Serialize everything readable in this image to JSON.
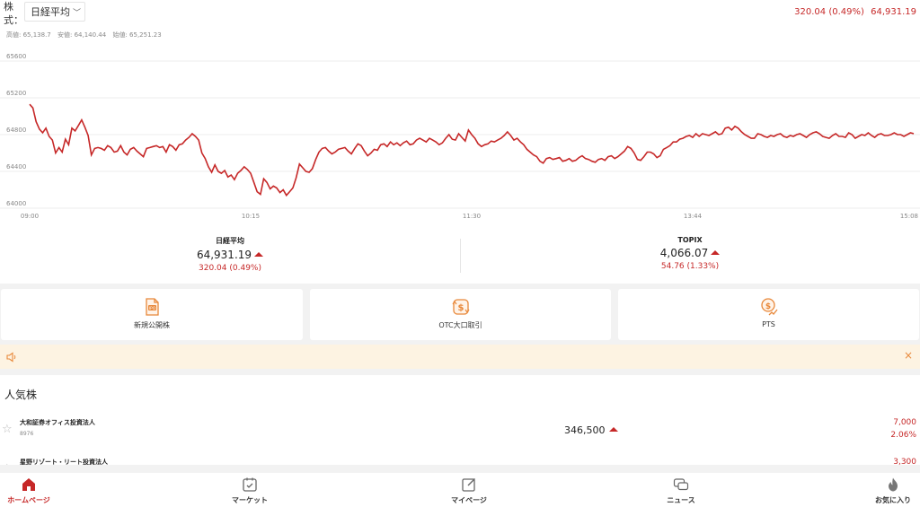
{
  "market": {
    "stock_label": "株式：",
    "selected_index": "日経平均",
    "top_change": "320.04 (0.49%)",
    "top_price": "64,931.19",
    "stats": [
      "高値: 65,138.7",
      "安値: 64,140.44",
      "始値: 65,251.23"
    ]
  },
  "chart_data": {
    "type": "line",
    "x_ticks": [
      "09:00",
      "10:15",
      "11:30",
      "13:44",
      "15:08"
    ],
    "y_ticks": [
      "65600",
      "65200",
      "64800",
      "64400",
      "64000"
    ],
    "ylim": [
      64000,
      65600
    ],
    "color": "#c62828",
    "grid": true,
    "series": [
      {
        "values": [
          65130,
          65090,
          64940,
          64860,
          64820,
          64870,
          64780,
          64740,
          64600,
          64660,
          64610,
          64750,
          64690,
          64870,
          64840,
          64900,
          64960,
          64880,
          64790,
          64580,
          64650,
          64660,
          64650,
          64630,
          64680,
          64660,
          64610,
          64620,
          64680,
          64610,
          64580,
          64640,
          64660,
          64620,
          64590,
          64560,
          64650,
          64660,
          64670,
          64680,
          64660,
          64670,
          64610,
          64690,
          64670,
          64630,
          64690,
          64700,
          64740,
          64770,
          64810,
          64780,
          64740,
          64600,
          64540,
          64450,
          64390,
          64470,
          64400,
          64380,
          64410,
          64340,
          64360,
          64310,
          64380,
          64410,
          64450,
          64420,
          64380,
          64280,
          64180,
          64150,
          64320,
          64280,
          64210,
          64240,
          64220,
          64170,
          64200,
          64140,
          64180,
          64220,
          64330,
          64480,
          64440,
          64400,
          64390,
          64430,
          64530,
          64610,
          64650,
          64660,
          64620,
          64590,
          64610,
          64640,
          64650,
          64660,
          64620,
          64590,
          64650,
          64700,
          64680,
          64620,
          64570,
          64600,
          64640,
          64630,
          64690,
          64700,
          64670,
          64720,
          64690,
          64710,
          64680,
          64710,
          64730,
          64690,
          64700,
          64740,
          64760,
          64740,
          64720,
          64760,
          64740,
          64720,
          64690,
          64710,
          64760,
          64800,
          64750,
          64740,
          64810,
          64770,
          64730,
          64850,
          64800,
          64760,
          64700,
          64670,
          64690,
          64700,
          64730,
          64720,
          64740,
          64760,
          64790,
          64830,
          64790,
          64740,
          64760,
          64720,
          64690,
          64640,
          64610,
          64580,
          64560,
          64510,
          64490,
          64540,
          64550,
          64530,
          64540,
          64550,
          64510,
          64520,
          64540,
          64510,
          64520,
          64550,
          64570,
          64540,
          64530,
          64510,
          64500,
          64530,
          64540,
          64520,
          64560,
          64570,
          64540,
          64560,
          64590,
          64620,
          64670,
          64650,
          64600,
          64530,
          64520,
          64560,
          64610,
          64610,
          64590,
          64550,
          64570,
          64640,
          64660,
          64680,
          64720,
          64720,
          64750,
          64760,
          64780,
          64790,
          64770,
          64810,
          64780,
          64810,
          64800,
          64790,
          64810,
          64830,
          64800,
          64810,
          64870,
          64880,
          64850,
          64890,
          64870,
          64830,
          64800,
          64780,
          64760,
          64760,
          64810,
          64800,
          64780,
          64770,
          64790,
          64780,
          64800,
          64810,
          64780,
          64770,
          64790,
          64780,
          64800,
          64810,
          64790,
          64770,
          64800,
          64820,
          64830,
          64810,
          64780,
          64770,
          64760,
          64790,
          64810,
          64780,
          64780,
          64770,
          64820,
          64800,
          64760,
          64780,
          64800,
          64790,
          64820,
          64790,
          64770,
          64800,
          64810,
          64790,
          64790,
          64800,
          64820,
          64800,
          64800,
          64780,
          64800,
          64820,
          64810
        ]
      }
    ]
  },
  "indices": [
    {
      "name": "日経平均",
      "value": "64,931.19",
      "change": "320.04 (0.49%)"
    },
    {
      "name": "TOPIX",
      "value": "4,066.07",
      "change": "54.76 (1.33%)"
    }
  ],
  "services": [
    {
      "label": "新規公開株",
      "icon": "ipo-icon"
    },
    {
      "label": "OTC大口取引",
      "icon": "otc-exchange-icon"
    },
    {
      "label": "PTS",
      "icon": "pts-icon"
    }
  ],
  "notice": {
    "close": "×"
  },
  "popular": {
    "title": "人気株",
    "rows": [
      {
        "name": "大和証券オフィス投資法人",
        "code": "8976",
        "price": "346,500",
        "change": "7,000",
        "change_pct": "2.06%"
      },
      {
        "name": "星野リゾート・リート投資法人",
        "code": "",
        "price": "",
        "change": "3,300",
        "change_pct": ""
      }
    ]
  },
  "nav": [
    {
      "label": "ホームページ",
      "icon": "home-icon",
      "active": true
    },
    {
      "label": "マーケット",
      "icon": "market-calendar-icon",
      "active": false
    },
    {
      "label": "マイページ",
      "icon": "edit-icon",
      "active": false
    },
    {
      "label": "ニュース",
      "icon": "chat-icon",
      "active": false
    },
    {
      "label": "お気に入り",
      "icon": "flame-icon",
      "active": false
    }
  ],
  "colors": {
    "accent": "#c62828",
    "orange": "#e8883a",
    "notice_bg": "#fdf3e2"
  }
}
